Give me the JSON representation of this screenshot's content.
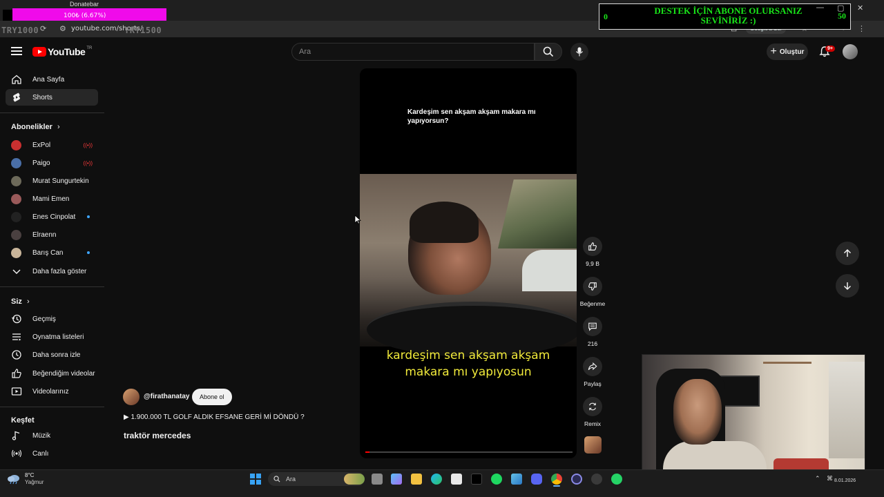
{
  "browser": {
    "url": "youtube.com/shorts/",
    "try_left": "TRY1000",
    "try_right": "TRY1500",
    "donate_label": "Donatebar",
    "donate_progress": "100₺ (6.67%)",
    "google_chip": "Google'a Sor",
    "promo_text": "DESTEK İÇİN ABONE OLURSANIZ SEVİNİRİZ :)",
    "promo_left": "0",
    "promo_right": "50"
  },
  "header": {
    "logo_text": "YouTube",
    "logo_region": "TR",
    "search_placeholder": "Ara",
    "create_label": "Oluştur",
    "notif_badge": "9+"
  },
  "sidebar": {
    "main": [
      {
        "label": "Ana Sayfa",
        "icon": "home-icon"
      },
      {
        "label": "Shorts",
        "icon": "shorts-icon",
        "active": true
      }
    ],
    "subs_title": "Abonelikler",
    "subs": [
      {
        "label": "ExPol",
        "indicator": "live",
        "color": "#c93030"
      },
      {
        "label": "Paigo",
        "indicator": "live",
        "color": "#4a6fa8"
      },
      {
        "label": "Murat Sungurtekin",
        "indicator": "",
        "color": "#6d6a5a"
      },
      {
        "label": "Mami Emen",
        "indicator": "",
        "color": "#9a5a5a"
      },
      {
        "label": "Enes Cinpolat",
        "indicator": "dot",
        "color": "#222222"
      },
      {
        "label": "Elraenn",
        "indicator": "",
        "color": "#4a4040"
      },
      {
        "label": "Barış Can",
        "indicator": "dot",
        "color": "#c9b59a"
      }
    ],
    "show_more": "Daha fazla göster",
    "you_title": "Siz",
    "you": [
      {
        "label": "Geçmiş",
        "icon": "history-icon"
      },
      {
        "label": "Oynatma listeleri",
        "icon": "playlists-icon"
      },
      {
        "label": "Daha sonra izle",
        "icon": "watch-later-icon"
      },
      {
        "label": "Beğendiğim videolar",
        "icon": "liked-icon"
      },
      {
        "label": "Videolarınız",
        "icon": "your-videos-icon"
      }
    ],
    "explore_title": "Keşfet",
    "explore": [
      {
        "label": "Müzik",
        "icon": "music-icon"
      },
      {
        "label": "Canlı",
        "icon": "live-icon"
      }
    ]
  },
  "short": {
    "caption": "Kardeşim sen akşam akşam makara mı yapıyorsun?",
    "subtitle_line1": "kardeşim sen akşam akşam",
    "subtitle_line2": "makara mı yapıyosun",
    "progress": 0.02,
    "likes": "9,9 B",
    "dislike_label": "Beğenme",
    "comments": "216",
    "share_label": "Paylaş",
    "remix_label": "Remix",
    "channel": "@firathanatay",
    "subscribe_label": "Abone ol",
    "music": "▶ 1.900.000 TL GOLF ALDIK EFSANE GERİ Mİ DÖNDÜ ?",
    "title": "traktör mercedes"
  },
  "taskbar": {
    "temp": "8°C",
    "weather": "Yağmur",
    "search_label": "Ara",
    "date": "8.01.2026"
  }
}
